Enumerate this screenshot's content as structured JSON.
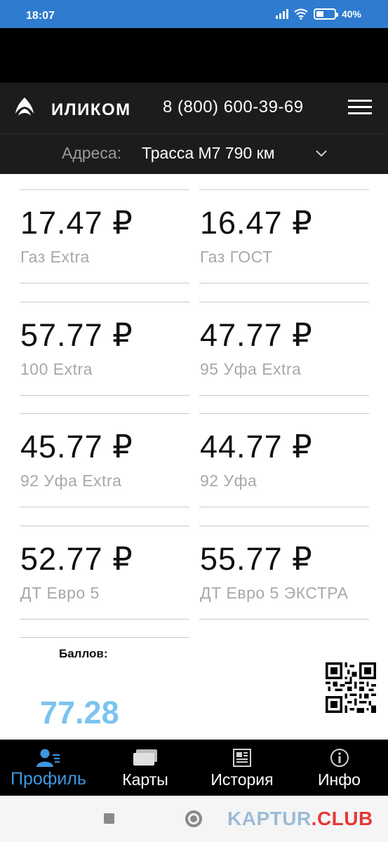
{
  "status_bar": {
    "time": "18:07",
    "battery_percent": "40%",
    "battery_level": 0.4
  },
  "header": {
    "logo_text": "ИЛИКОМ",
    "phone": "8 (800) 600-39-69",
    "menu_icon": "hamburger-menu-icon"
  },
  "address": {
    "label": "Адреса:",
    "value": "Трасса М7 790 км"
  },
  "prices": [
    {
      "price": "17.47 ₽",
      "fuel": "Газ Extra"
    },
    {
      "price": "16.47 ₽",
      "fuel": "Газ ГОСТ"
    },
    {
      "price": "57.77 ₽",
      "fuel": "100 Extra"
    },
    {
      "price": "47.77 ₽",
      "fuel": "95 Уфа Extra"
    },
    {
      "price": "45.77 ₽",
      "fuel": "92 Уфа Extra"
    },
    {
      "price": "44.77 ₽",
      "fuel": "92 Уфа"
    },
    {
      "price": "52.77 ₽",
      "fuel": "ДТ Евро 5"
    },
    {
      "price": "55.77 ₽",
      "fuel": "ДТ Евро 5 ЭКСТРА"
    }
  ],
  "points": {
    "label": "Баллов:",
    "value": "77.28"
  },
  "bottom_nav": [
    {
      "label": "Профиль",
      "icon": "profile-icon",
      "active": true
    },
    {
      "label": "Карты",
      "icon": "cards-icon",
      "active": false
    },
    {
      "label": "История",
      "icon": "history-icon",
      "active": false
    },
    {
      "label": "Инфо",
      "icon": "info-icon",
      "active": false
    }
  ],
  "watermark": {
    "part1": "KAPTUR",
    "part2": ".CLUB"
  },
  "colors": {
    "status_bar": "#2e7bcf",
    "header_bg": "#1c1c1c",
    "active_nav": "#3f97e0",
    "points_value": "#7bc3f0"
  }
}
